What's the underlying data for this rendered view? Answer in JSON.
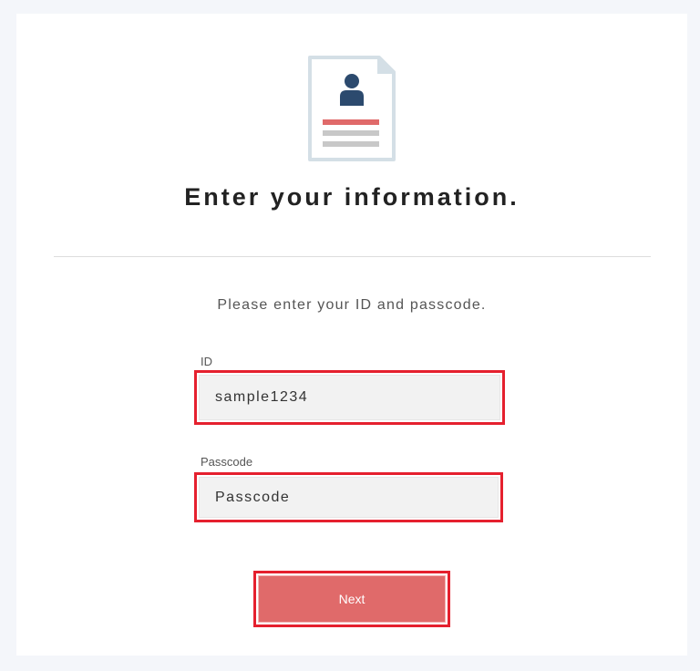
{
  "header": {
    "icon": "user-document-icon",
    "title": "Enter your information."
  },
  "form": {
    "instruction": "Please enter your ID and passcode.",
    "id_field": {
      "label": "ID",
      "value": "sample1234"
    },
    "passcode_field": {
      "label": "Passcode",
      "placeholder": "Passcode",
      "value": ""
    },
    "next_label": "Next"
  },
  "colors": {
    "accent": "#e06a6a",
    "highlight": "#e5202e",
    "icon_primary": "#2c4a6e",
    "icon_stroke": "#d4dfe6"
  }
}
